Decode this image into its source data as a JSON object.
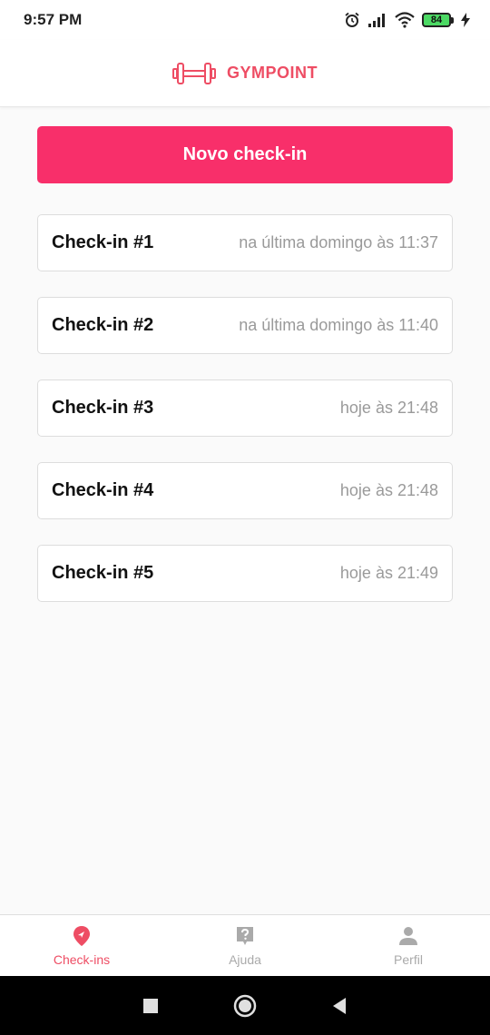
{
  "status_bar": {
    "time": "9:57 PM",
    "battery_level": "84"
  },
  "header": {
    "brand": "GYMPOINT",
    "brand_color": "#ee4d64",
    "logo_icon": "dumbbell-icon"
  },
  "actions": {
    "new_checkin_label": "Novo check-in",
    "accent_color": "#f82f6a"
  },
  "checkins": [
    {
      "title": "Check-in #1",
      "time": "na última domingo às 11:37"
    },
    {
      "title": "Check-in #2",
      "time": "na última domingo às 11:40"
    },
    {
      "title": "Check-in #3",
      "time": "hoje às 21:48"
    },
    {
      "title": "Check-in #4",
      "time": "hoje às 21:48"
    },
    {
      "title": "Check-in #5",
      "time": "hoje às 21:49"
    }
  ],
  "tabs": [
    {
      "label": "Check-ins",
      "icon": "location-pin-icon",
      "active": true
    },
    {
      "label": "Ajuda",
      "icon": "help-question-icon",
      "active": false
    },
    {
      "label": "Perfil",
      "icon": "person-icon",
      "active": false
    }
  ],
  "system_nav": {
    "icons": [
      "square-recents-icon",
      "circle-home-icon",
      "triangle-back-icon"
    ]
  }
}
